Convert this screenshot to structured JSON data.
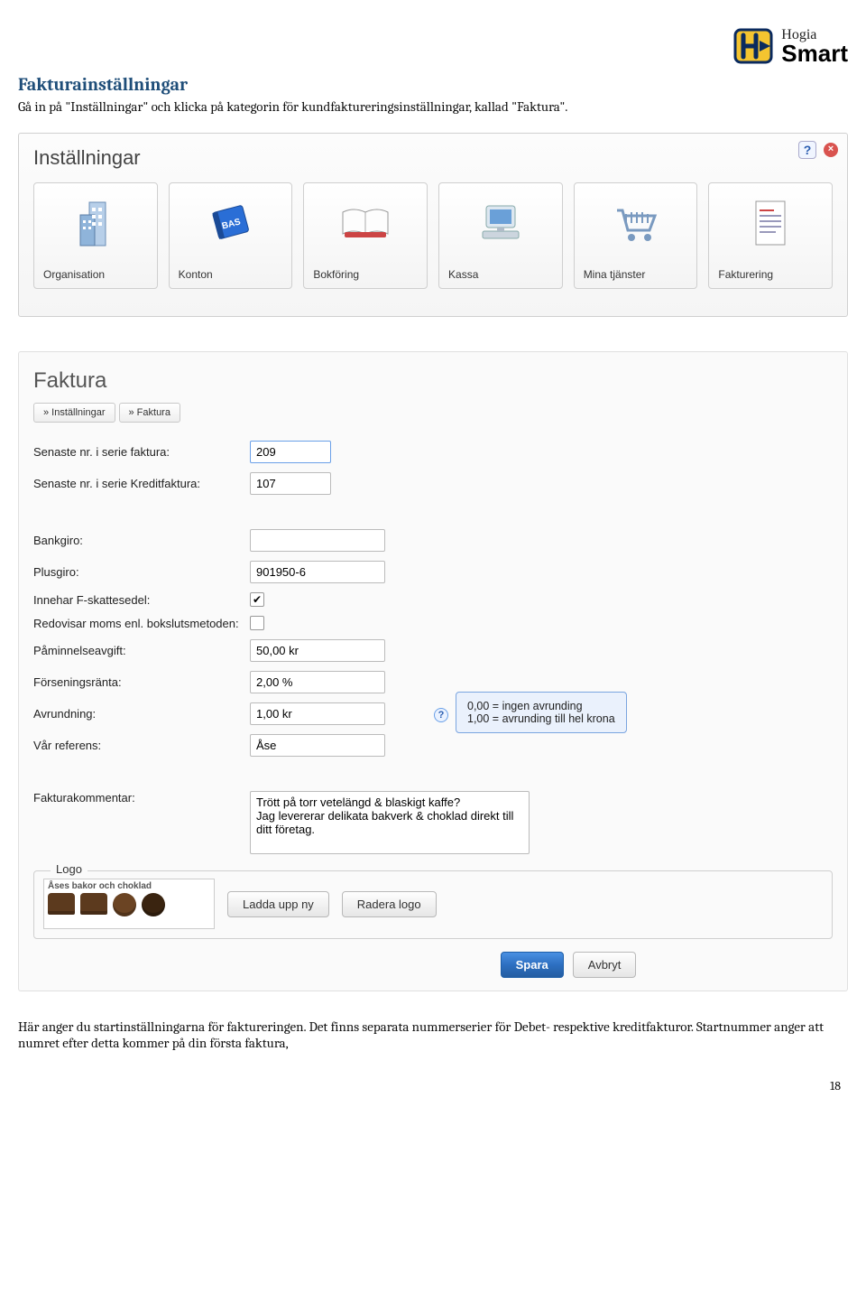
{
  "brand": {
    "name1": "Hogia",
    "name2": "Smart"
  },
  "doc": {
    "heading": "Fakturainställningar",
    "intro": "Gå in på \"Inställningar\" och klicka på kategorin för kundfaktureringsinställningar, kallad \"Faktura\".",
    "outro": "Här anger du startinställningarna för faktureringen. Det finns separata nummerserier för Debet- respektive kreditfakturor. Startnummer anger att numret efter detta kommer på din första faktura,",
    "page_number": "18"
  },
  "settings_panel": {
    "title": "Inställningar",
    "tiles": [
      {
        "id": "organisation",
        "label": "Organisation"
      },
      {
        "id": "konton",
        "label": "Konton"
      },
      {
        "id": "bokforing",
        "label": "Bokföring"
      },
      {
        "id": "kassa",
        "label": "Kassa"
      },
      {
        "id": "mina-tjanster",
        "label": "Mina tjänster"
      },
      {
        "id": "fakturering",
        "label": "Fakturering"
      }
    ]
  },
  "faktura_panel": {
    "title": "Faktura",
    "breadcrumb": [
      "» Inställningar",
      "» Faktura"
    ],
    "fields": {
      "serie_faktura_label": "Senaste nr. i serie faktura:",
      "serie_faktura_value": "209",
      "serie_kreditfaktura_label": "Senaste nr. i serie Kreditfaktura:",
      "serie_kreditfaktura_value": "107",
      "bankgiro_label": "Bankgiro:",
      "bankgiro_value": "",
      "plusgiro_label": "Plusgiro:",
      "plusgiro_value": "901950-6",
      "fskatt_label": "Innehar F-skattesedel:",
      "fskatt_checked": true,
      "bokslut_label": "Redovisar moms enl. bokslutsmetoden:",
      "bokslut_checked": false,
      "paminnelse_label": "Påminnelseavgift:",
      "paminnelse_value": "50,00 kr",
      "forsening_label": "Förseningsränta:",
      "forsening_value": "2,00 %",
      "avrundning_label": "Avrundning:",
      "avrundning_value": "1,00 kr",
      "avrundning_tooltip_l1": "0,00 = ingen avrunding",
      "avrundning_tooltip_l2": "1,00 = avrunding till hel krona",
      "var_ref_label": "Vår referens:",
      "var_ref_value": "Åse",
      "kommentar_label": "Fakturakommentar:",
      "kommentar_value": "Trött på torr vetelängd & blaskigt kaffe?\nJag levererar delikata bakverk & choklad direkt till ditt företag."
    },
    "logo": {
      "legend": "Logo",
      "caption": "Åses bakor och choklad",
      "upload_label": "Ladda upp ny",
      "delete_label": "Radera logo"
    },
    "actions": {
      "save": "Spara",
      "cancel": "Avbryt"
    }
  }
}
